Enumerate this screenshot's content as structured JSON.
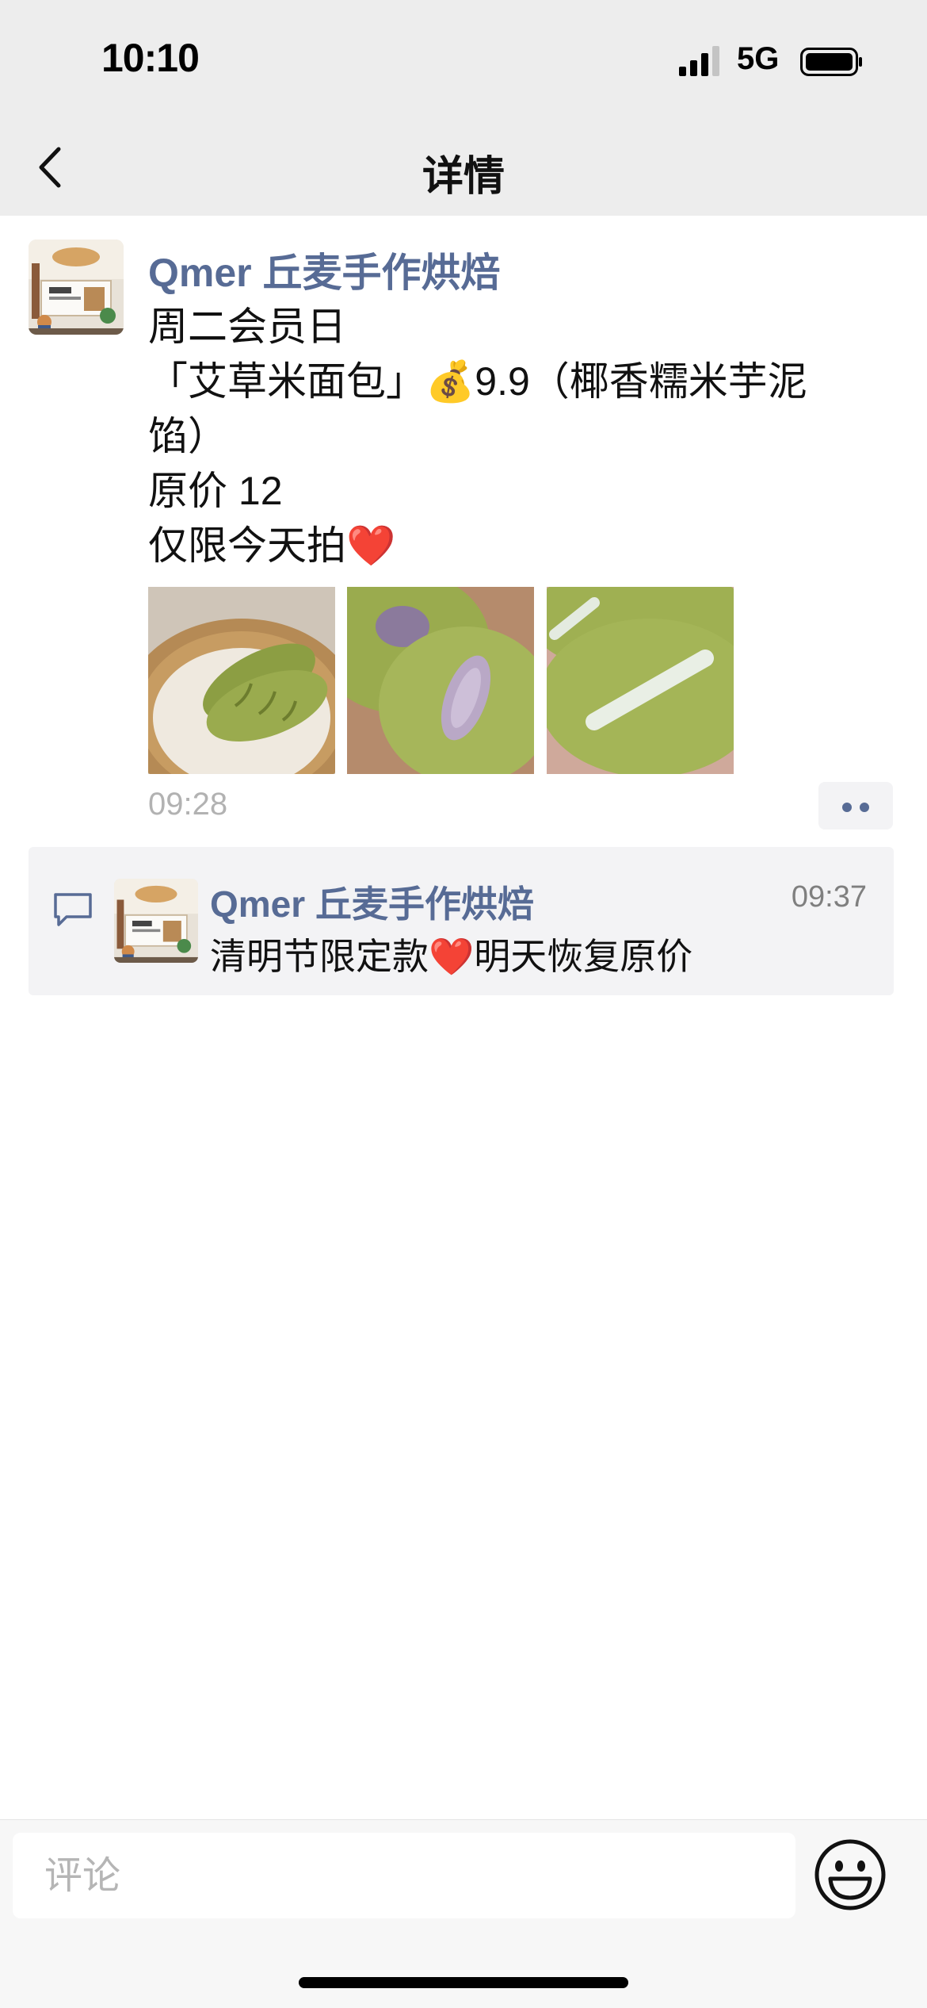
{
  "status_bar": {
    "time": "10:10",
    "network": "5G"
  },
  "nav": {
    "title": "详情",
    "back_icon": "chevron-left-icon"
  },
  "post": {
    "author": "Qmer 丘麦手作烘焙",
    "lines": [
      "周二会员日",
      "「艾草米面包」💰9.9（椰香糯米芋泥馅）",
      "原价 12",
      "仅限今天拍❤️"
    ],
    "images": [
      "bread-basket-photo",
      "bread-taro-cut-photo",
      "bread-cross-section-photo"
    ],
    "time": "09:28",
    "more_icon": "more-dots-icon"
  },
  "comments": [
    {
      "author": "Qmer 丘麦手作烘焙",
      "time": "09:37",
      "text": "清明节限定款❤️明天恢复原价"
    }
  ],
  "bottom_bar": {
    "comment_placeholder": "评论",
    "emoji_icon": "smiley-face-icon"
  },
  "colors": {
    "link_blue": "#576b95",
    "header_bg": "#ededed",
    "comment_bg": "#f3f3f5",
    "bread_green": "#a3b556"
  }
}
